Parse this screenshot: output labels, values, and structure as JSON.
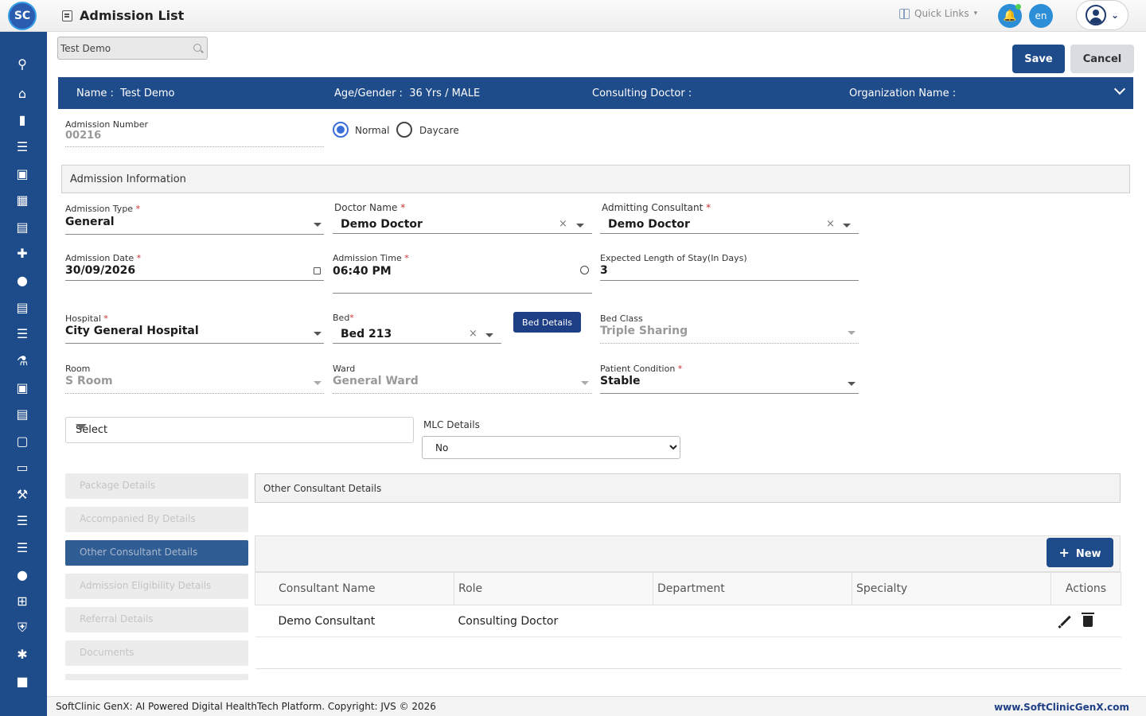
{
  "topbar": {
    "logo": "SC",
    "title": "Admission List",
    "quick_links": "Quick Links",
    "lang": "en"
  },
  "search": {
    "value": "Test Demo"
  },
  "actions": {
    "save": "Save",
    "cancel": "Cancel"
  },
  "patient": {
    "name_label": "Name :",
    "name": "Test Demo",
    "age_gender_label": "Age/Gender :",
    "age_gender": "36 Yrs / MALE",
    "consulting_doctor_label": "Consulting Doctor :",
    "organization_label": "Organization Name :"
  },
  "admission": {
    "number_label": "Admission Number",
    "number": "00216",
    "mode_options": [
      "Normal",
      "Daycare"
    ],
    "mode_selected": "Normal"
  },
  "section_title": "Admission Information",
  "fields": {
    "admission_type_label": "Admission Type",
    "admission_type": "General",
    "doctor_name_label": "Doctor Name",
    "doctor_name": "Demo Doctor",
    "admitting_consultant_label": "Admitting Consultant",
    "admitting_consultant": "Demo Doctor",
    "admission_date_label": "Admission Date",
    "admission_date": "30/09/2026",
    "admission_time_label": "Admission Time",
    "admission_time": "06:40 PM",
    "expected_stay_label": "Expected Length of Stay(In Days)",
    "expected_stay": "3",
    "hospital_label": "Hospital",
    "hospital": "City General Hospital",
    "bed_label": "Bed",
    "bed": "Bed 213",
    "bed_details_button": "Bed Details",
    "bed_class_label": "Bed Class",
    "bed_class": "Triple Sharing",
    "room_label": "Room",
    "room": "S Room",
    "ward_label": "Ward",
    "ward": "General Ward",
    "patient_condition_label": "Patient Condition",
    "patient_condition": "Stable",
    "select_placeholder": "Select",
    "mlc_label": "MLC Details",
    "mlc_value": "No"
  },
  "side_tabs": [
    "Package Details",
    "Accompanied By Details",
    "Other Consultant Details",
    "Admission Eligibility Details",
    "Referral Details",
    "Documents"
  ],
  "ocd": {
    "title": "Other Consultant Details",
    "new_button": "New",
    "columns": [
      "Consultant Name",
      "Role",
      "Department",
      "Specialty",
      "Actions"
    ],
    "rows": [
      {
        "consultant_name": "Demo Consultant",
        "role": "Consulting Doctor",
        "department": "",
        "specialty": ""
      }
    ]
  },
  "footer": {
    "copyright": "SoftClinic GenX: AI Powered Digital HealthTech Platform. Copyright: JVS © 2026",
    "website": "www.SoftClinicGenX.com"
  },
  "colors": {
    "primary": "#1e4b8a",
    "accent": "#2b8ed6",
    "required": "#d32f2f"
  }
}
